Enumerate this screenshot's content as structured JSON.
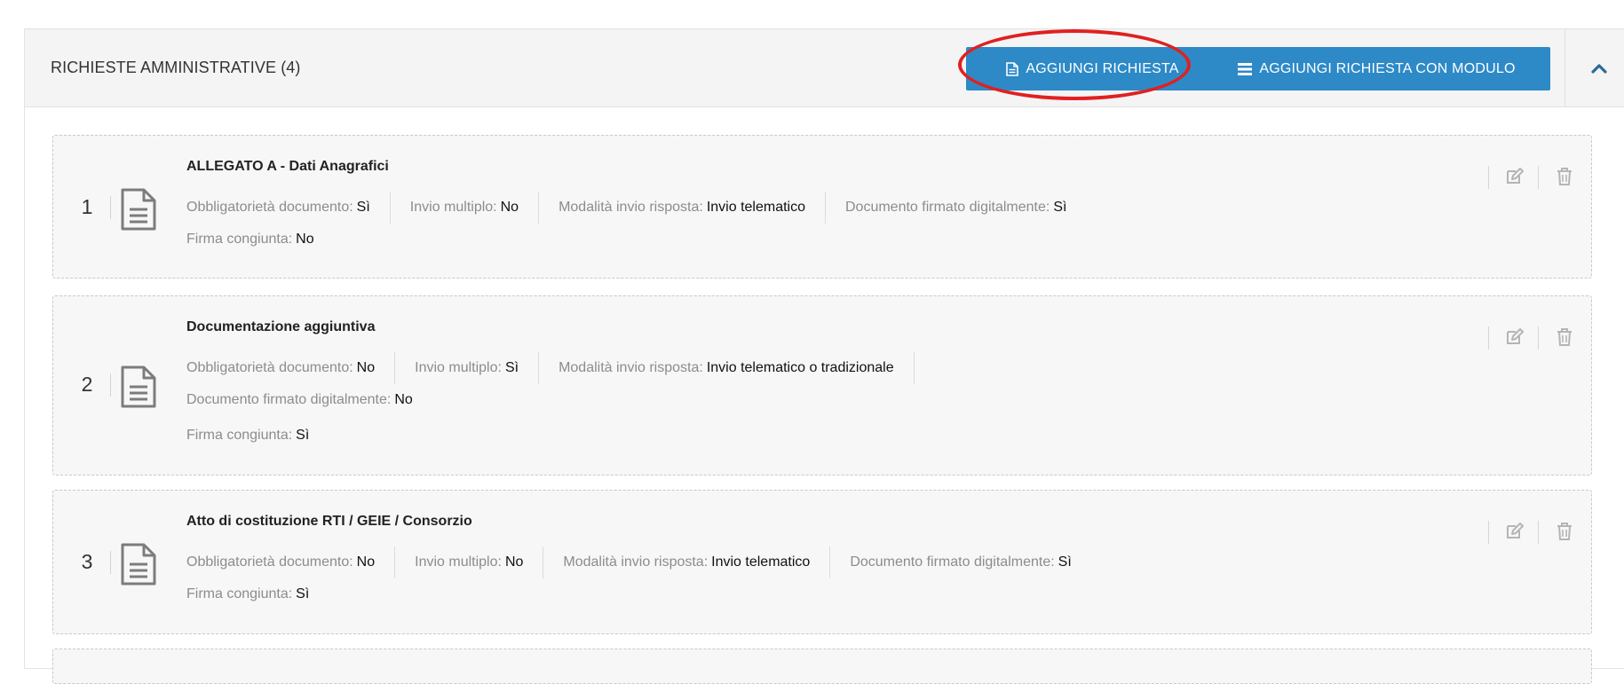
{
  "panel": {
    "title": "RICHIESTE AMMINISTRATIVE (4)",
    "add_button_label": "AGGIUNGI RICHIESTA",
    "add_module_button_label": "AGGIUNGI RICHIESTA CON MODULO",
    "accent_color": "#2d8ac7",
    "highlight_color": "#e02020"
  },
  "requests": [
    {
      "number": "1",
      "title": "ALLEGATO A - Dati Anagrafici",
      "obbligatorieta_label": "Obbligatorietà documento:",
      "obbligatorieta_value": "Sì",
      "invio_multiplo_label": "Invio multiplo:",
      "invio_multiplo_value": "No",
      "modalita_label": "Modalità invio risposta:",
      "modalita_value": "Invio telematico",
      "firmato_label": "Documento firmato digitalmente:",
      "firmato_value": "Sì",
      "firma_congiunta_label": "Firma congiunta:",
      "firma_congiunta_value": "No"
    },
    {
      "number": "2",
      "title": "Documentazione aggiuntiva",
      "obbligatorieta_label": "Obbligatorietà documento:",
      "obbligatorieta_value": "No",
      "invio_multiplo_label": "Invio multiplo:",
      "invio_multiplo_value": "Sì",
      "modalita_label": "Modalità invio risposta:",
      "modalita_value": "Invio telematico o tradizionale",
      "firmato_label": "Documento firmato digitalmente:",
      "firmato_value": "No",
      "firma_congiunta_label": "Firma congiunta:",
      "firma_congiunta_value": "Sì"
    },
    {
      "number": "3",
      "title": "Atto di costituzione RTI / GEIE / Consorzio",
      "obbligatorieta_label": "Obbligatorietà documento:",
      "obbligatorieta_value": "No",
      "invio_multiplo_label": "Invio multiplo:",
      "invio_multiplo_value": "No",
      "modalita_label": "Modalità invio risposta:",
      "modalita_value": "Invio telematico",
      "firmato_label": "Documento firmato digitalmente:",
      "firmato_value": "Sì",
      "firma_congiunta_label": "Firma congiunta:",
      "firma_congiunta_value": "Sì"
    }
  ],
  "icons": {
    "add_button": "file-text-icon",
    "add_module_button": "list-icon",
    "collapse": "chevron-up-icon",
    "request": "document-icon",
    "edit": "edit-icon",
    "delete": "trash-icon"
  }
}
